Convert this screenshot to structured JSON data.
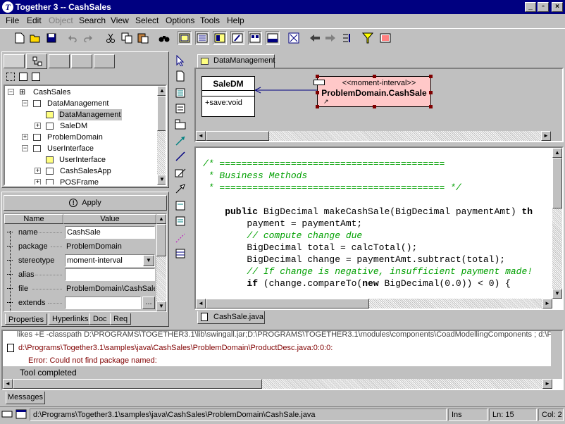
{
  "window": {
    "title": "Together 3 -- CashSales",
    "controls": {
      "min": "_",
      "max": "▫",
      "close": "×"
    }
  },
  "menu": [
    "File",
    "Edit",
    "Object",
    "Search",
    "View",
    "Select",
    "Options",
    "Tools",
    "Help"
  ],
  "tree": {
    "items": [
      {
        "label": "CashSales"
      },
      {
        "label": "DataManagement"
      },
      {
        "label": "DataManagement"
      },
      {
        "label": "SaleDM"
      },
      {
        "label": "ProblemDomain"
      },
      {
        "label": "UserInterface"
      },
      {
        "label": "UserInterface"
      },
      {
        "label": "CashSalesApp"
      },
      {
        "label": "POSFrame"
      }
    ]
  },
  "inspector": {
    "apply_label": "Apply",
    "col_name": "Name",
    "col_value": "Value",
    "rows": [
      {
        "name": "name",
        "value": "CashSale"
      },
      {
        "name": "package",
        "value": "ProblemDomain"
      },
      {
        "name": "stereotype",
        "value": "moment-interval"
      },
      {
        "name": "alias",
        "value": ""
      },
      {
        "name": "file",
        "value": "ProblemDomain\\CashSale"
      },
      {
        "name": "extends",
        "value": ""
      }
    ],
    "more_button": "...",
    "tabs": [
      "Properties",
      "Hyperlinks",
      "Doc",
      "Req"
    ]
  },
  "diagram": {
    "tab": "DataManagement",
    "class1": {
      "name": "SaleDM",
      "op": "+save:void"
    },
    "class2": {
      "stereotype": "<<moment-interval>>",
      "name": "ProblemDomain.CashSale",
      "shortcut": "↗"
    }
  },
  "editor": {
    "lines": [
      "/* =========================================",
      " * Business Methods",
      " * ========================================= */",
      "",
      "    public BigDecimal makeCashSale(BigDecimal paymentAmt) th",
      "        payment = paymentAmt;",
      "        // compute change due",
      "        BigDecimal total = calcTotal();",
      "        BigDecimal change = paymentAmt.subtract(total);",
      "        // If change is negative, insufficient payment made!",
      "        if (change.compareTo(new BigDecimal(0.0)) < 0) {"
    ],
    "file_tab": "CashSale.java"
  },
  "messages": {
    "lines": [
      "likes +E -classpath  D:\\PROGRAMS\\TOGETHER3.1\\lib\\swingall.jar;D:\\PROGRAMS\\TOGETHER3.1\\modules\\components\\CoadModellingComponents ; d:\\P",
      "d:\\Programs\\Together3.1\\samples\\java\\CashSales\\ProblemDomain\\ProductDesc.java:0:0:0:",
      "Error: Could not find package named:",
      "Tool completed"
    ],
    "tab": "Messages"
  },
  "status": {
    "path": "d:\\Programs\\Together3.1\\samples\\java\\CashSales\\ProblemDomain\\CashSale.java",
    "mode": "Ins",
    "line": "Ln: 15",
    "col": "Col: 2"
  },
  "colors": {
    "titlebar": "#000080",
    "class_fill": "#ffc8c8",
    "comment": "#00a000",
    "error": "#800000"
  }
}
